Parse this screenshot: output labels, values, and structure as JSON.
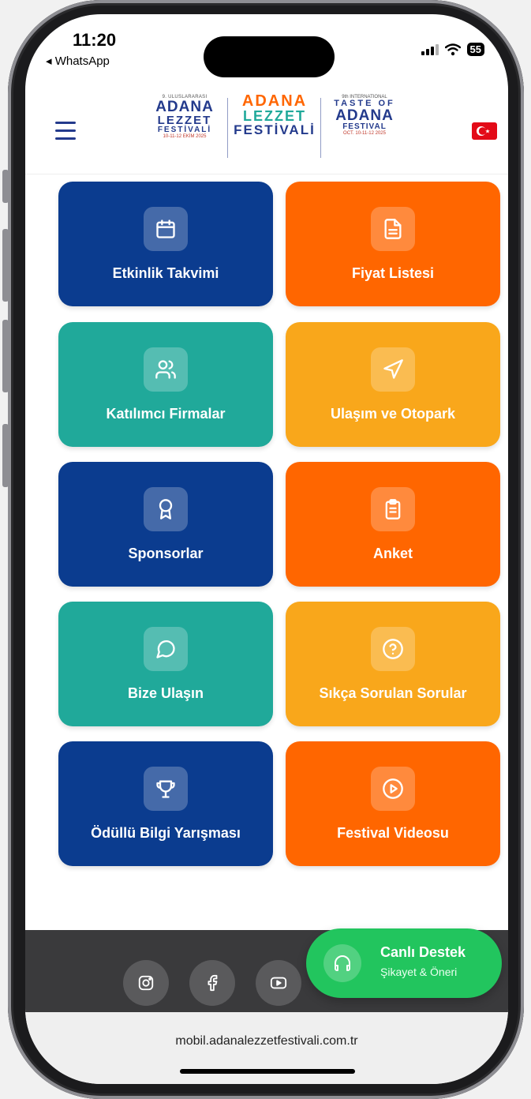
{
  "status_bar": {
    "time": "11:20",
    "back_app": "◂ WhatsApp",
    "battery": "55"
  },
  "header": {
    "menu_icon": "hamburger-icon",
    "logo_left": {
      "line1": "9. ULUSLARARASI",
      "line2": "ADANA",
      "line3": "LEZZET",
      "line4": "FESTİVALİ",
      "dates": "10-11-12 EKİM 2025"
    },
    "logo_center": {
      "line1": "ADANA",
      "line2": "LEZZET",
      "line3": "FESTİVALİ"
    },
    "logo_right": {
      "line1": "9th INTERNATIONAL",
      "line2": "TASTE OF",
      "line3": "ADANA",
      "line4": "FESTIVAL",
      "dates": "OCT. 10-11-12 2025"
    },
    "language_flag": "turkey-flag-icon"
  },
  "tiles": [
    {
      "label": "Etkinlik Takvimi",
      "icon": "calendar-icon",
      "color": "#0b3c8f"
    },
    {
      "label": "Fiyat Listesi",
      "icon": "document-icon",
      "color": "#ff6600"
    },
    {
      "label": "Katılımcı Firmalar",
      "icon": "users-icon",
      "color": "#20a99a"
    },
    {
      "label": "Ulaşım ve Otopark",
      "icon": "navigation-icon",
      "color": "#f9a71b"
    },
    {
      "label": "Sponsorlar",
      "icon": "award-icon",
      "color": "#0b3c8f"
    },
    {
      "label": "Anket",
      "icon": "clipboard-icon",
      "color": "#ff6600"
    },
    {
      "label": "Bize Ulaşın",
      "icon": "chat-bubble-icon",
      "color": "#20a99a"
    },
    {
      "label": "Sıkça Sorulan Sorular",
      "icon": "help-circle-icon",
      "color": "#f9a71b"
    },
    {
      "label": "Ödüllü Bilgi Yarışması",
      "icon": "trophy-icon",
      "color": "#0b3c8f"
    },
    {
      "label": "Festival Videosu",
      "icon": "play-circle-icon",
      "color": "#ff6600"
    }
  ],
  "social": [
    "instagram-icon",
    "facebook-icon",
    "youtube-icon"
  ],
  "support": {
    "title": "Canlı Destek",
    "subtitle": "Şikayet & Öneri",
    "icon": "headphones-icon"
  },
  "browser": {
    "url": "mobil.adanalezzetfestivali.com.tr"
  }
}
